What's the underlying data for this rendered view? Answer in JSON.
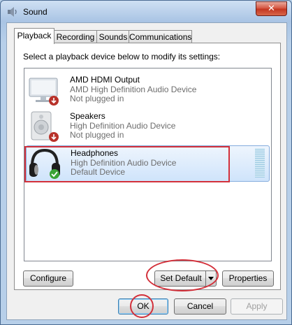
{
  "window": {
    "title": "Sound"
  },
  "tabs": [
    {
      "label": "Playback",
      "active": true
    },
    {
      "label": "Recording",
      "active": false
    },
    {
      "label": "Sounds",
      "active": false
    },
    {
      "label": "Communications",
      "active": false
    }
  ],
  "instruction": "Select a playback device below to modify its settings:",
  "devices": [
    {
      "name": "AMD HDMI Output",
      "description": "AMD High Definition Audio Device",
      "status": "Not plugged in",
      "icon": "hdmi-monitor-icon"
    },
    {
      "name": "Speakers",
      "description": "High Definition Audio Device",
      "status": "Not plugged in",
      "icon": "speaker-icon"
    },
    {
      "name": "Headphones",
      "description": "High Definition Audio Device",
      "status": "Default Device",
      "icon": "headphones-icon",
      "selected": true
    }
  ],
  "buttons": {
    "configure": "Configure",
    "set_default": "Set Default",
    "properties": "Properties",
    "ok": "OK",
    "cancel": "Cancel",
    "apply": "Apply"
  },
  "colors": {
    "annotation": "#d3303a",
    "selection": "#cfe4fb"
  }
}
